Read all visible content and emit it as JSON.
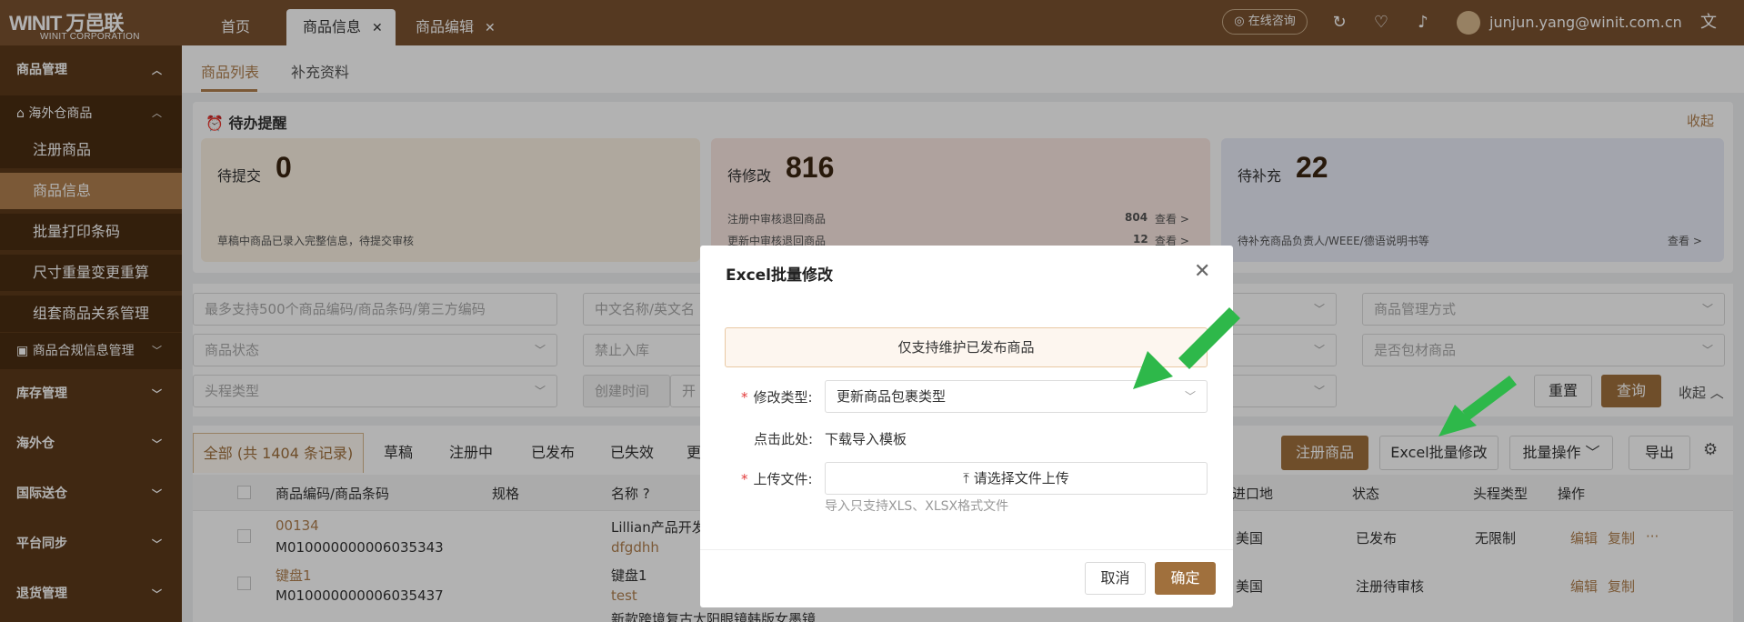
{
  "topbar": {
    "logo_brand": "WINIT 万邑联",
    "logo_sub": "WINIT CORPORATION",
    "tabs": [
      {
        "label": "首页"
      },
      {
        "label": "商品信息",
        "close": "✕"
      },
      {
        "label": "商品编辑",
        "close": "✕"
      }
    ],
    "consult": "在线咨询",
    "user_email": "junjun.yang@winit.com.cn"
  },
  "sidebar": {
    "groups": [
      {
        "label": "商品管理"
      },
      {
        "label": "海外仓商品"
      },
      {
        "label": "注册商品"
      },
      {
        "label": "商品信息"
      },
      {
        "label": "批量打印条码"
      },
      {
        "label": "尺寸重量变更重算"
      },
      {
        "label": "组套商品关系管理"
      },
      {
        "label": "商品合规信息管理"
      },
      {
        "label": "库存管理"
      },
      {
        "label": "海外仓"
      },
      {
        "label": "国际送仓"
      },
      {
        "label": "平台同步"
      },
      {
        "label": "退货管理"
      }
    ]
  },
  "subtabs": [
    "商品列表",
    "补充资料"
  ],
  "todo": {
    "title": "待办提醒",
    "collapse": "收起",
    "cards": [
      {
        "title": "待提交",
        "count": "0",
        "desc": "草稿中商品已录入完整信息，待提交审核"
      },
      {
        "title": "待修改",
        "count": "816",
        "rows": [
          {
            "label": "注册中审核退回商品",
            "count": "804",
            "link": "查看 >"
          },
          {
            "label": "更新中审核退回商品",
            "count": "12",
            "link": "查看 >"
          }
        ]
      },
      {
        "title": "待补充",
        "count": "22",
        "desc": "待补充商品负责人/WEEE/德语说明书等",
        "link": "查看 >"
      }
    ]
  },
  "filters": {
    "code_placeholder": "最多支持500个商品编码/商品条码/第三方编码",
    "name_placeholder": "中文名称/英文名",
    "status": "商品状态",
    "forbid": "禁止入库",
    "mgmt": "商品管理方式",
    "pack": "是否包材商品",
    "head": "头程类型",
    "ctime": "创建时间",
    "ctime_to": "开",
    "reset": "重置",
    "query": "查询",
    "collapse": "收起"
  },
  "list_tabs": [
    "全部 (共 1404 条记录)",
    "草稿",
    "注册中",
    "已发布",
    "已失效",
    "更"
  ],
  "actions": {
    "register": "注册商品",
    "excel": "Excel批量修改",
    "batch": "批量操作",
    "export": "导出"
  },
  "columns": {
    "code": "商品编码/商品条码",
    "spec": "规格",
    "name": "名称",
    "country": "进口地",
    "status": "状态",
    "head": "头程类型",
    "ops": "操作"
  },
  "rows": [
    {
      "code": "00134",
      "barcode": "M010000000006035343",
      "name": "Lillian产品开发",
      "name2": "dfgdhh",
      "country": "美国",
      "status": "已发布",
      "head": "无限制",
      "edit": "编辑",
      "copy": "复制",
      "more": "···"
    },
    {
      "code": "键盘1",
      "barcode": "M010000000006035437",
      "name": "键盘1",
      "name2": "test",
      "country": "美国",
      "status": "注册待审核",
      "head": "",
      "edit": "编辑",
      "copy": "复制",
      "more": ""
    },
    {
      "name": "新款跨境复古太阳眼镜韩版女墨镜"
    }
  ],
  "modal": {
    "title": "Excel批量修改",
    "notice": "仅支持维护已发布商品",
    "type_label": "修改类型:",
    "type_value": "更新商品包裹类型",
    "template_label": "点击此处:",
    "template_link": "下载导入模板",
    "upload_label": "上传文件:",
    "upload_btn": "请选择文件上传",
    "hint": "导入只支持XLS、XLSX格式文件",
    "cancel": "取消",
    "ok": "确定"
  },
  "colors": {
    "brand": "#7a5230",
    "accent": "#a0703d",
    "arrow": "#2eb84a"
  }
}
